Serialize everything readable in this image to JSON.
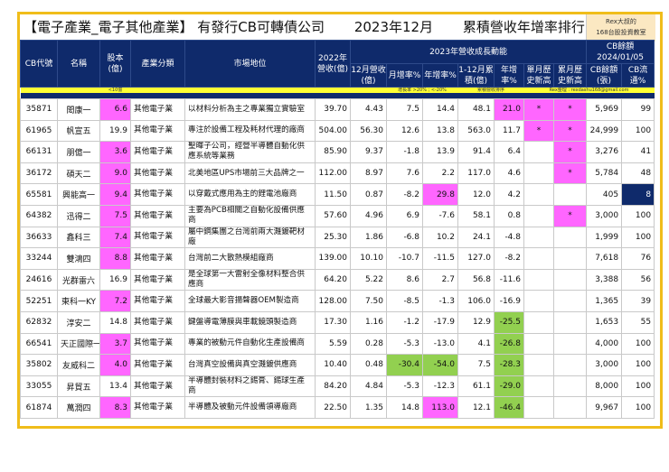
{
  "title": {
    "main": "【電子產業_電子其他產業】 有發行CB可轉債公司",
    "month": "2023年12月",
    "ranking": "累積營收年增率排行"
  },
  "rex_box": {
    "line1": "Rex大叔的",
    "line2": "168台股投資教室"
  },
  "headers": {
    "cb_code": "CB代號",
    "name": "名稱",
    "capital": "股本(億)",
    "industry": "產業分類",
    "market": "市場地位",
    "rev2022": "2022年營收(億)",
    "group2023": "2023年營收成長動能",
    "cb_group": "CB餘額",
    "cb_date": "2024/01/05",
    "dec_rev": "12月營收(億)",
    "mom": "月增率%",
    "yoy": "年增率%",
    "cum_rev": "1-12月累積(億)",
    "cum_yoy": "年增率%",
    "month_high": "單月歷史新高",
    "cum_high": "累月歷史新高",
    "cb_balance": "CB餘額(張)",
    "cb_float": "CB流通%"
  },
  "legend": {
    "capital_note": "<10億",
    "growth_note": "增長率 >20% ; <-20%",
    "sort_note": "累積營收排序",
    "contact": "Rex整理 : rexdashu168@gmail.com"
  },
  "colors": {
    "navy": "#0f2a6b",
    "pink": "#ff66ff",
    "green": "#92d050",
    "yellow": "#ffff33",
    "frame": "#f0bd1a"
  },
  "rows": [
    {
      "code": "35871",
      "name": "閎康一",
      "cap": "6.6",
      "ind": "其他電子業",
      "mkt": "以材料分析為主之專業獨立實驗室",
      "r22": "39.70",
      "dec": "4.43",
      "mom": "7.5",
      "yoy": "14.4",
      "cum": "48.1",
      "cyoy": "21.0",
      "mh": "*",
      "ch": "*",
      "cb": "5,969",
      "fl": "99",
      "hl": {
        "cap": "pk",
        "cyoy": "pk",
        "mh": "pk",
        "ch": "pk"
      }
    },
    {
      "code": "61965",
      "name": "帆宣五",
      "cap": "19.9",
      "ind": "其他電子業",
      "mkt": "專注於設備工程及耗材代理的廠商",
      "r22": "504.00",
      "dec": "56.30",
      "mom": "12.6",
      "yoy": "13.8",
      "cum": "563.0",
      "cyoy": "11.7",
      "mh": "*",
      "ch": "*",
      "cb": "24,999",
      "fl": "100",
      "hl": {
        "mh": "pk",
        "ch": "pk"
      }
    },
    {
      "code": "66131",
      "name": "朋億一",
      "cap": "3.6",
      "ind": "其他電子業",
      "mkt": "聖暉子公司，經營半導體自動化供應系統等業務",
      "r22": "85.90",
      "dec": "9.37",
      "mom": "-1.8",
      "yoy": "13.9",
      "cum": "91.4",
      "cyoy": "6.4",
      "mh": "",
      "ch": "*",
      "cb": "3,276",
      "fl": "41",
      "hl": {
        "cap": "pk",
        "ch": "pk"
      }
    },
    {
      "code": "36172",
      "name": "碩天二",
      "cap": "9.0",
      "ind": "其他電子業",
      "mkt": "北美地區UPS市場前三大品牌之一",
      "r22": "112.00",
      "dec": "8.97",
      "mom": "7.6",
      "yoy": "2.2",
      "cum": "117.0",
      "cyoy": "4.6",
      "mh": "",
      "ch": "*",
      "cb": "5,784",
      "fl": "48",
      "hl": {
        "cap": "pk",
        "ch": "pk"
      }
    },
    {
      "code": "65581",
      "name": "興能高一",
      "cap": "9.4",
      "ind": "其他電子業",
      "mkt": "以穿戴式應用為主的鋰電池廠商",
      "r22": "11.50",
      "dec": "0.87",
      "mom": "-8.2",
      "yoy": "29.8",
      "cum": "12.0",
      "cyoy": "4.2",
      "mh": "",
      "ch": "",
      "cb": "405",
      "fl": "8",
      "hl": {
        "cap": "pk",
        "yoy": "pk",
        "fl": "nv"
      }
    },
    {
      "code": "64382",
      "name": "迅得二",
      "cap": "7.5",
      "ind": "其他電子業",
      "mkt": "主要為PCB相關之自動化設備供應商",
      "r22": "57.60",
      "dec": "4.96",
      "mom": "6.9",
      "yoy": "-7.6",
      "cum": "58.1",
      "cyoy": "0.8",
      "mh": "",
      "ch": "*",
      "cb": "3,000",
      "fl": "100",
      "hl": {
        "cap": "pk",
        "ch": "pk"
      }
    },
    {
      "code": "36633",
      "name": "鑫科三",
      "cap": "7.4",
      "ind": "其他電子業",
      "mkt": "屬中鋼集團之台灣前兩大濺鍍靶材廠",
      "r22": "25.30",
      "dec": "1.86",
      "mom": "-6.8",
      "yoy": "10.2",
      "cum": "24.1",
      "cyoy": "-4.8",
      "mh": "",
      "ch": "",
      "cb": "1,999",
      "fl": "100",
      "hl": {
        "cap": "pk"
      }
    },
    {
      "code": "33244",
      "name": "雙鴻四",
      "cap": "8.8",
      "ind": "其他電子業",
      "mkt": "台灣前二大散熱模組廠商",
      "r22": "139.00",
      "dec": "10.10",
      "mom": "-10.7",
      "yoy": "-11.5",
      "cum": "127.0",
      "cyoy": "-8.2",
      "mh": "",
      "ch": "",
      "cb": "7,618",
      "fl": "76",
      "hl": {
        "cap": "pk"
      }
    },
    {
      "code": "24616",
      "name": "光群雷六",
      "cap": "16.9",
      "ind": "其他電子業",
      "mkt": "是全球第一大雷射全像材料整合供應商",
      "r22": "64.20",
      "dec": "5.22",
      "mom": "8.6",
      "yoy": "2.7",
      "cum": "56.8",
      "cyoy": "-11.6",
      "mh": "",
      "ch": "",
      "cb": "3,388",
      "fl": "56",
      "hl": {}
    },
    {
      "code": "52251",
      "name": "東科一KY",
      "cap": "7.2",
      "ind": "其他電子業",
      "mkt": "全球最大影音揚聲器OEM製造商",
      "r22": "128.00",
      "dec": "7.50",
      "mom": "-8.5",
      "yoy": "-1.3",
      "cum": "106.0",
      "cyoy": "-16.9",
      "mh": "",
      "ch": "",
      "cb": "1,365",
      "fl": "39",
      "hl": {
        "cap": "pk"
      }
    },
    {
      "code": "62832",
      "name": "淳安二",
      "cap": "14.8",
      "ind": "其他電子業",
      "mkt": "鍵盤導電薄膜與車載鏡頭製造商",
      "r22": "17.30",
      "dec": "1.16",
      "mom": "-1.2",
      "yoy": "-17.9",
      "cum": "12.9",
      "cyoy": "-25.5",
      "mh": "",
      "ch": "",
      "cb": "1,653",
      "fl": "55",
      "hl": {
        "cyoy": "gr"
      }
    },
    {
      "code": "66541",
      "name": "天正國際一",
      "cap": "3.7",
      "ind": "其他電子業",
      "mkt": "專業的被動元件自動化生產設備商",
      "r22": "5.59",
      "dec": "0.28",
      "mom": "-5.3",
      "yoy": "-13.0",
      "cum": "4.1",
      "cyoy": "-26.8",
      "mh": "",
      "ch": "",
      "cb": "4,000",
      "fl": "100",
      "hl": {
        "cap": "pk",
        "cyoy": "gr"
      }
    },
    {
      "code": "35802",
      "name": "友威科二",
      "cap": "4.0",
      "ind": "其他電子業",
      "mkt": "台灣真空設備與真空濺鍍供應商",
      "r22": "10.40",
      "dec": "0.48",
      "mom": "-30.4",
      "yoy": "-54.0",
      "cum": "7.5",
      "cyoy": "-28.3",
      "mh": "",
      "ch": "",
      "cb": "3,000",
      "fl": "100",
      "hl": {
        "cap": "pk",
        "mom": "gr",
        "yoy": "gr",
        "cyoy": "gr"
      }
    },
    {
      "code": "33055",
      "name": "昇貿五",
      "cap": "13.4",
      "ind": "其他電子業",
      "mkt": "半導體封裝材料之錫膏、錫球生產商",
      "r22": "84.20",
      "dec": "4.84",
      "mom": "-5.3",
      "yoy": "-12.3",
      "cum": "61.1",
      "cyoy": "-29.0",
      "mh": "",
      "ch": "",
      "cb": "8,000",
      "fl": "100",
      "hl": {
        "cyoy": "gr"
      }
    },
    {
      "code": "61874",
      "name": "萬潤四",
      "cap": "8.3",
      "ind": "其他電子業",
      "mkt": "半導體及被動元件設備領導廠商",
      "r22": "22.50",
      "dec": "1.35",
      "mom": "14.8",
      "yoy": "113.0",
      "cum": "12.1",
      "cyoy": "-46.4",
      "mh": "",
      "ch": "",
      "cb": "9,967",
      "fl": "100",
      "hl": {
        "cap": "pk",
        "yoy": "pk",
        "cyoy": "gr"
      }
    }
  ]
}
